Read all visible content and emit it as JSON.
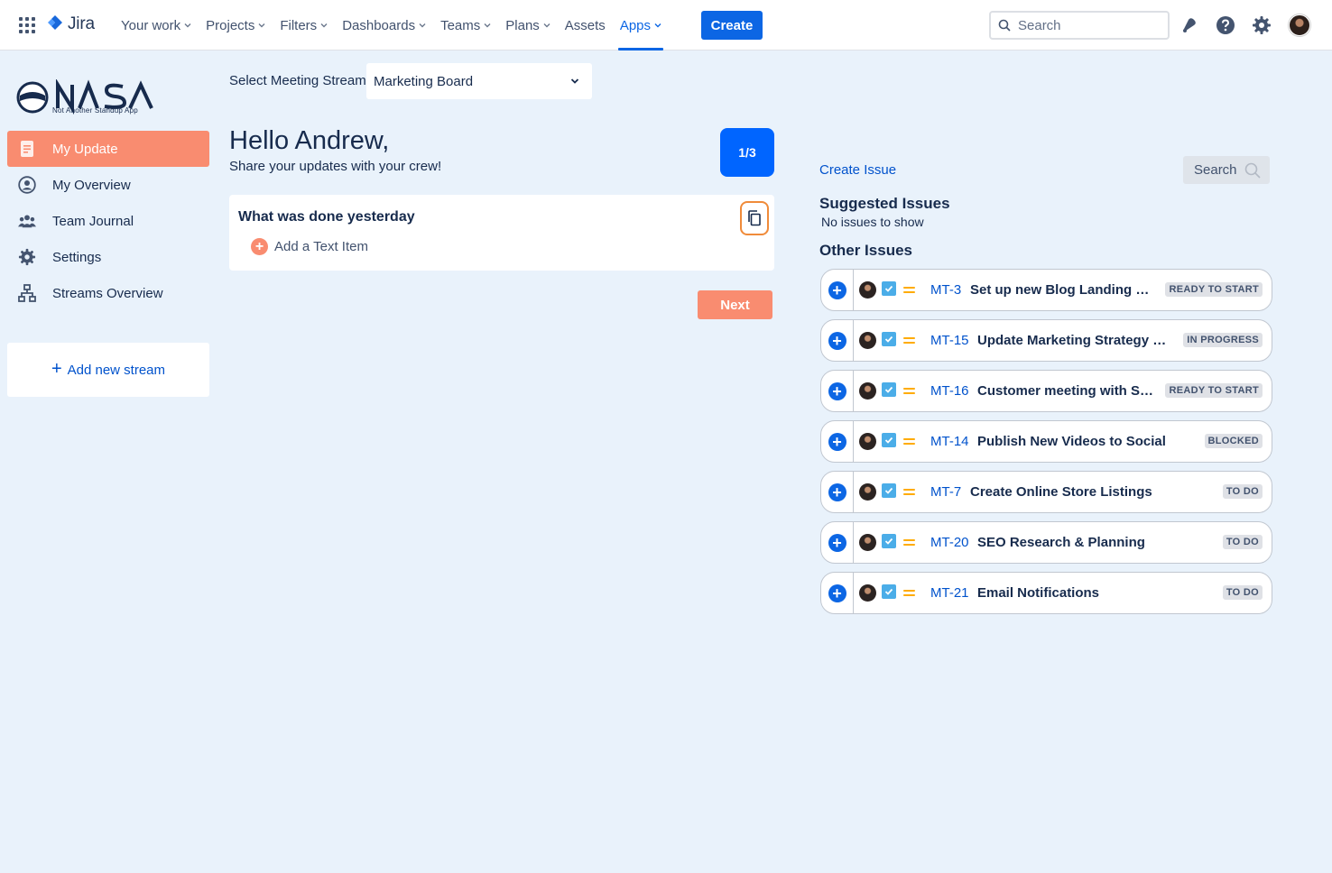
{
  "topnav": {
    "product": "Jira",
    "items": [
      {
        "label": "Your work",
        "dropdown": true
      },
      {
        "label": "Projects",
        "dropdown": true
      },
      {
        "label": "Filters",
        "dropdown": true
      },
      {
        "label": "Dashboards",
        "dropdown": true
      },
      {
        "label": "Teams",
        "dropdown": true
      },
      {
        "label": "Plans",
        "dropdown": true
      },
      {
        "label": "Assets",
        "dropdown": false
      },
      {
        "label": "Apps",
        "dropdown": true,
        "active": true
      }
    ],
    "create_label": "Create",
    "search_placeholder": "Search",
    "icons": [
      "notifications-icon",
      "help-icon",
      "settings-icon",
      "profile-avatar"
    ]
  },
  "sidebar": {
    "logo_text": "NASA",
    "logo_tagline": "Not Another Standup App",
    "items": [
      {
        "label": "My Update",
        "icon": "document-icon",
        "active": true
      },
      {
        "label": "My Overview",
        "icon": "person-circle-icon"
      },
      {
        "label": "Team Journal",
        "icon": "people-icon"
      },
      {
        "label": "Settings",
        "icon": "gear-icon"
      },
      {
        "label": "Streams Overview",
        "icon": "hierarchy-icon"
      }
    ],
    "add_stream_label": "Add new stream"
  },
  "main": {
    "stream_label": "Select Meeting Stream",
    "stream_value": "Marketing Board",
    "greeting": "Hello Andrew,",
    "subtitle": "Share your updates with your crew!",
    "step": "1/3",
    "section_title": "What was done yesterday",
    "add_text_label": "Add a Text Item",
    "next_label": "Next"
  },
  "issues_panel": {
    "create_issue_label": "Create Issue",
    "search_label": "Search",
    "suggested_title": "Suggested Issues",
    "no_issues_text": "No issues to show",
    "other_title": "Other Issues",
    "issues": [
      {
        "key": "MT-3",
        "summary": "Set up new Blog Landing Page",
        "status": "READY TO START"
      },
      {
        "key": "MT-15",
        "summary": "Update Marketing Strategy wit...",
        "status": "IN PROGRESS"
      },
      {
        "key": "MT-16",
        "summary": "Customer meeting with Sp...",
        "status": "READY TO START"
      },
      {
        "key": "MT-14",
        "summary": "Publish New Videos to Social",
        "status": "BLOCKED"
      },
      {
        "key": "MT-7",
        "summary": "Create Online Store Listings",
        "status": "TO DO"
      },
      {
        "key": "MT-20",
        "summary": "SEO Research & Planning",
        "status": "TO DO"
      },
      {
        "key": "MT-21",
        "summary": "Email Notifications",
        "status": "TO DO"
      }
    ]
  },
  "colors": {
    "page_bg": "#e9f2fb",
    "primary": "#0c66e4",
    "accent": "#f98c70",
    "text": "#172b4d"
  }
}
